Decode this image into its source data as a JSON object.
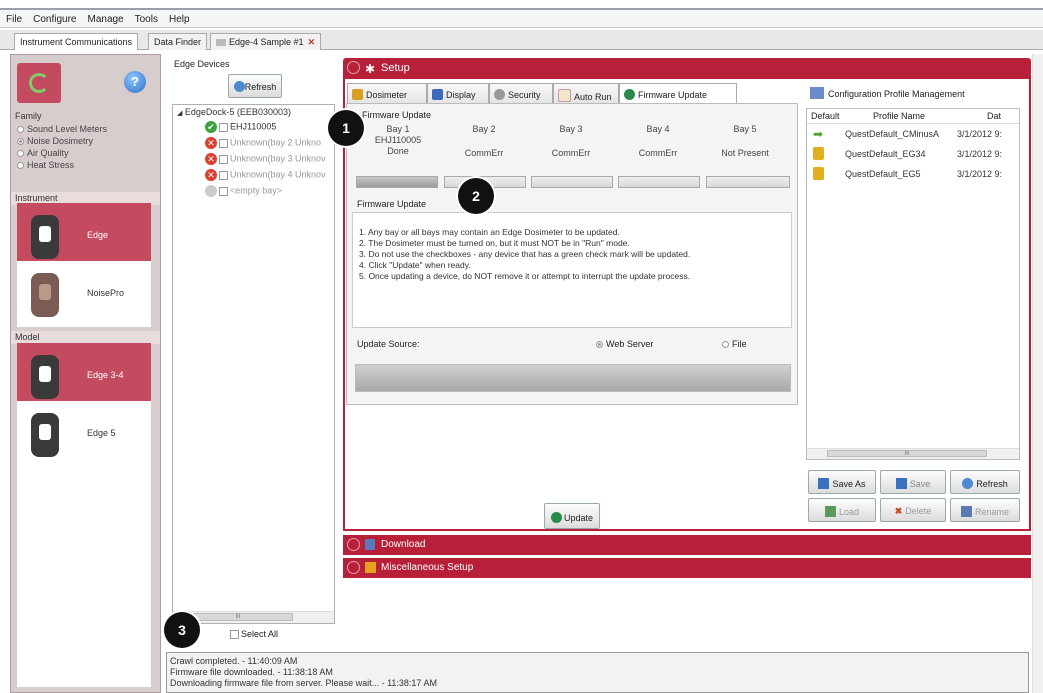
{
  "menu": [
    "File",
    "Configure",
    "Manage",
    "Tools",
    "Help"
  ],
  "doc_tabs": [
    {
      "label": "Instrument Communications"
    },
    {
      "label": "Data Finder"
    },
    {
      "label": "Edge-4 Sample #1"
    }
  ],
  "left": {
    "family_label": "Family",
    "family_options": [
      "Sound Level Meters",
      "Noise Dosimetry",
      "Air Quality",
      "Heat Stress"
    ],
    "family_selected": "Noise Dosimetry",
    "instrument_label": "Instrument",
    "instruments": [
      "Edge",
      "NoisePro"
    ],
    "model_label": "Model",
    "models": [
      "Edge 3-4",
      "Edge 5"
    ]
  },
  "devices": {
    "title": "Edge Devices",
    "refresh": "Refresh",
    "dock": "EdgeDock-5 (EEB030003)",
    "bays": [
      {
        "label": "EHJ110005",
        "status": "ok"
      },
      {
        "label": "Unknown(bay 2 Unkno",
        "status": "err"
      },
      {
        "label": "Unknown(bay 3 Unknov",
        "status": "err"
      },
      {
        "label": "Unknown(bay 4 Unknov",
        "status": "err"
      },
      {
        "label": "<empty bay>",
        "status": "empty"
      }
    ],
    "scroll_label": "III",
    "select_all": "Select All"
  },
  "setup": {
    "title": "Setup",
    "tabs": [
      "Dosimeter",
      "Display",
      "Security",
      "Auto Run",
      "Firmware Update"
    ],
    "fw_heading": "Firmware Update",
    "bays": [
      {
        "name": "Bay 1",
        "serial": "EHJ110005",
        "status": "Done"
      },
      {
        "name": "Bay 2",
        "serial": "",
        "status": "CommErr"
      },
      {
        "name": "Bay 3",
        "serial": "",
        "status": "CommErr"
      },
      {
        "name": "Bay 4",
        "serial": "",
        "status": "CommErr"
      },
      {
        "name": "Bay 5",
        "serial": "",
        "status": "Not Present"
      }
    ],
    "fw_box_label": "Firmware Update",
    "instructions": [
      "1. Any bay or all bays may contain an Edge Dosimeter to be updated.",
      "2. The Dosimeter must be turned on, but it must NOT be in \"Run\" mode.",
      "3. Do not use the checkboxes - any device that has a green check mark will be updated.",
      "4. Click \"Update\" when ready.",
      "5. Once updating a device, do NOT remove it or attempt to interrupt the update process."
    ],
    "update_source_label": "Update Source:",
    "source_options": [
      "Web Server",
      "File"
    ],
    "source_selected": "Web Server",
    "update_button": "Update"
  },
  "cpm": {
    "title": "Configuration Profile Management",
    "columns": [
      "Default",
      "Profile Name",
      "Dat"
    ],
    "rows": [
      {
        "icon": "arrow-icon",
        "name": "QuestDefault_CMinusA",
        "date": "3/1/2012 9:"
      },
      {
        "icon": "lock-icon",
        "name": "QuestDefault_EG34",
        "date": "3/1/2012 9:"
      },
      {
        "icon": "lock-icon",
        "name": "QuestDefault_EG5",
        "date": "3/1/2012 9:"
      }
    ],
    "scroll_label": "III",
    "buttons": [
      "Save As",
      "Save",
      "Refresh",
      "Load",
      "Delete",
      "Rename"
    ]
  },
  "sections": [
    "Download",
    "Miscellaneous Setup"
  ],
  "badges": [
    "1",
    "2",
    "3"
  ],
  "log": [
    "Crawl completed. - 11:40:09 AM",
    "Firmware file downloaded. - 11:38:18 AM",
    "Downloading firmware file from server.  Please wait... - 11:38:17 AM"
  ],
  "colors": {
    "accent": "#b8203a",
    "selected_card": "#c44a60"
  }
}
